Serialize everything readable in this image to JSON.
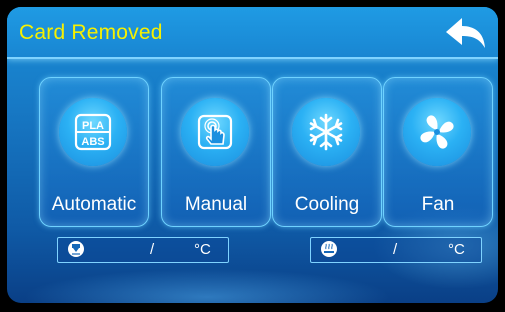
{
  "header": {
    "status_text": "Card Removed"
  },
  "modes": [
    {
      "label": "Automatic",
      "icon": "pla-abs-icon",
      "icon_text_top": "PLA",
      "icon_text_bottom": "ABS"
    },
    {
      "label": "Manual",
      "icon": "touch-hand-icon"
    },
    {
      "label": "Cooling",
      "icon": "snowflake-icon"
    },
    {
      "label": "Fan",
      "icon": "fan-icon"
    }
  ],
  "temps": [
    {
      "icon": "nozzle-icon",
      "value": "/",
      "unit": "°C"
    },
    {
      "icon": "heated-bed-icon",
      "value": "/",
      "unit": "°C"
    }
  ],
  "colors": {
    "accent": "#f7f000",
    "panel": "#1986d2"
  }
}
